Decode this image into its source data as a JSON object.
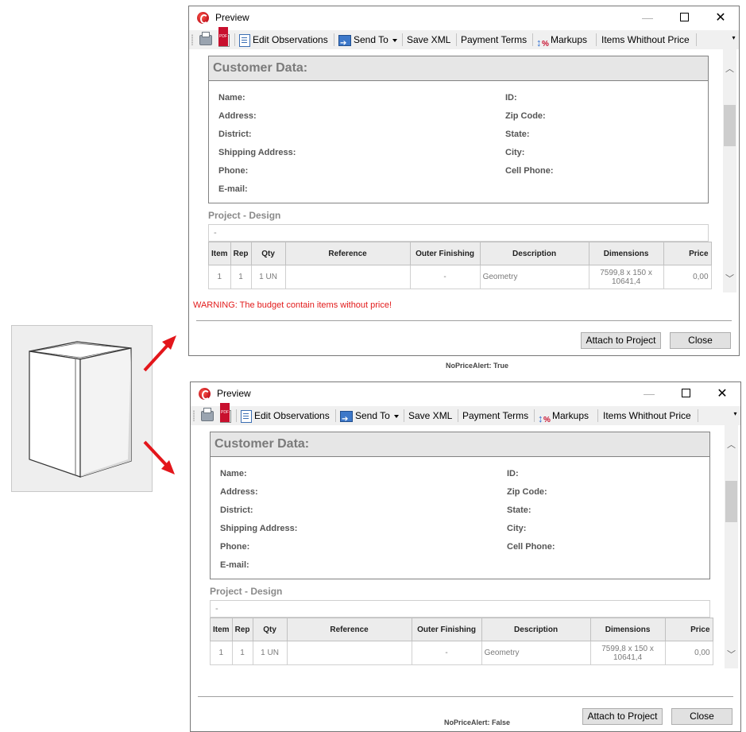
{
  "windows": [
    {
      "title": "Preview",
      "toolbar": {
        "edit_observations": "Edit Observations",
        "send_to": "Send To",
        "save_xml": "Save XML",
        "payment_terms": "Payment Terms",
        "markups": "Markups",
        "items_without_price": "Items Whithout Price"
      },
      "customer": {
        "header": "Customer Data:",
        "name": "Name:",
        "address": "Address:",
        "district": "District:",
        "shipping_address": "Shipping Address:",
        "phone": "Phone:",
        "email": "E-mail:",
        "id": "ID:",
        "zip_code": "Zip Code:",
        "state": "State:",
        "city": "City:",
        "cell_phone": "Cell Phone:"
      },
      "project_label": "Project - Design",
      "project_value": "-",
      "table": {
        "headers": [
          "Item",
          "Rep",
          "Qty",
          "Reference",
          "Outer Finishing",
          "Description",
          "Dimensions",
          "Price"
        ],
        "rows": [
          [
            "1",
            "1",
            "1 UN",
            "",
            "-",
            "Geometry",
            "7599,8 x 150 x 10641,4",
            "0,00"
          ]
        ]
      },
      "warning": "WARNING: The budget contain items without price!",
      "attach_button": "Attach to Project",
      "close_button": "Close",
      "caption": "NoPriceAlert: True"
    },
    {
      "title": "Preview",
      "toolbar": {
        "edit_observations": "Edit Observations",
        "send_to": "Send To",
        "save_xml": "Save XML",
        "payment_terms": "Payment Terms",
        "markups": "Markups",
        "items_without_price": "Items Whithout Price"
      },
      "customer": {
        "header": "Customer Data:",
        "name": "Name:",
        "address": "Address:",
        "district": "District:",
        "shipping_address": "Shipping Address:",
        "phone": "Phone:",
        "email": "E-mail:",
        "id": "ID:",
        "zip_code": "Zip Code:",
        "state": "State:",
        "city": "City:",
        "cell_phone": "Cell Phone:"
      },
      "project_label": "Project - Design",
      "project_value": "-",
      "table": {
        "headers": [
          "Item",
          "Rep",
          "Qty",
          "Reference",
          "Outer Finishing",
          "Description",
          "Dimensions",
          "Price"
        ],
        "rows": [
          [
            "1",
            "1",
            "1 UN",
            "",
            "-",
            "Geometry",
            "7599,8 x 150 x 10641,4",
            "0,00"
          ]
        ]
      },
      "warning": "",
      "attach_button": "Attach to Project",
      "close_button": "Close",
      "caption": "NoPriceAlert: False"
    }
  ],
  "colors": {
    "warning": "#e21b1b",
    "arrow": "#e3161b"
  }
}
